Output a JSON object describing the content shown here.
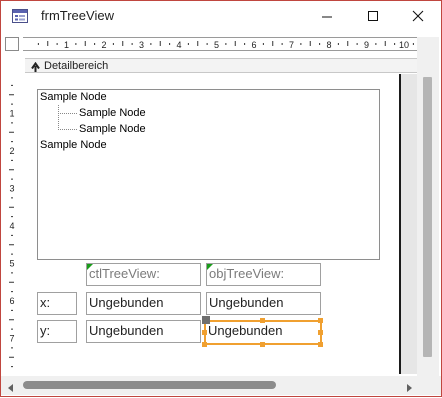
{
  "window": {
    "title": "frmTreeView",
    "icon": "form-window-icon",
    "controls": [
      "minimize-icon",
      "maximize-icon",
      "close-icon"
    ]
  },
  "ruler": {
    "horizontal_numbers": [
      "1",
      "2",
      "3",
      "4",
      "5",
      "6",
      "7",
      "8",
      "9",
      "10"
    ],
    "vertical_numbers": [
      "1",
      "2",
      "3",
      "4",
      "5",
      "6",
      "7"
    ]
  },
  "section": {
    "label": "Detailbereich"
  },
  "tree": {
    "nodes": [
      {
        "text": "Sample Node",
        "level": 0
      },
      {
        "text": "Sample Node",
        "level": 1
      },
      {
        "text": "Sample Node",
        "level": 1
      },
      {
        "text": "Sample Node",
        "level": 0
      }
    ]
  },
  "controls": {
    "header_left": "ctlTreeView:",
    "header_right": "objTreeView:",
    "x_label": "x:",
    "y_label": "y:",
    "x_left_value": "Ungebunden",
    "x_right_value": "Ungebunden",
    "y_left_value": "Ungebunden",
    "y_right_value": "Ungebunden"
  },
  "colors": {
    "window_border": "#c0463f",
    "selection": "#f0a030",
    "label_marker": "#1a9c1a"
  }
}
